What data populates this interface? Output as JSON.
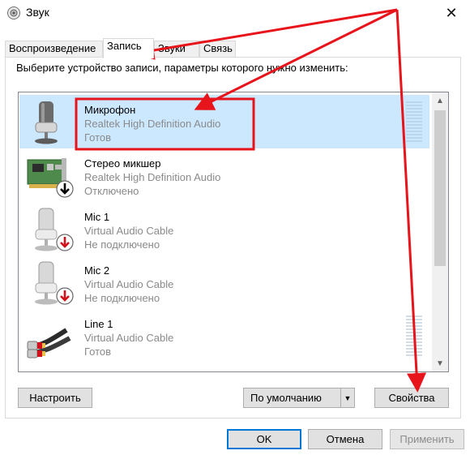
{
  "window": {
    "title": "Звук",
    "close_label": "✕"
  },
  "tabs": [
    {
      "label": "Воспроизведение",
      "active": false
    },
    {
      "label": "Запись",
      "active": true
    },
    {
      "label": "Звуки",
      "active": false
    },
    {
      "label": "Связь",
      "active": false
    }
  ],
  "instruction": "Выберите устройство записи, параметры которого нужно изменить:",
  "devices": [
    {
      "name": "Микрофон",
      "driver": "Realtek High Definition Audio",
      "status": "Готов",
      "icon": "microphone-icon",
      "selected": true
    },
    {
      "name": "Стерео микшер",
      "driver": "Realtek High Definition Audio",
      "status": "Отключено",
      "icon": "sound-card-icon",
      "badge": "disabled-down-arrow-badge"
    },
    {
      "name": "Mic 1",
      "driver": "Virtual Audio Cable",
      "status": "Не подключено",
      "icon": "microphone-icon",
      "badge": "unplugged-red-arrow-badge"
    },
    {
      "name": "Mic 2",
      "driver": "Virtual Audio Cable",
      "status": "Не подключено",
      "icon": "microphone-icon",
      "badge": "unplugged-red-arrow-badge"
    },
    {
      "name": "Line 1",
      "driver": "Virtual Audio Cable",
      "status": "Готов",
      "icon": "audio-cable-icon"
    }
  ],
  "buttons": {
    "configure": "Настроить",
    "set_default": "По умолчанию",
    "properties": "Свойства",
    "ok": "OK",
    "cancel": "Отмена",
    "apply": "Применить"
  },
  "colors": {
    "annotation": "#e8141b",
    "selection": "#cce8ff",
    "focus": "#0078d7"
  }
}
